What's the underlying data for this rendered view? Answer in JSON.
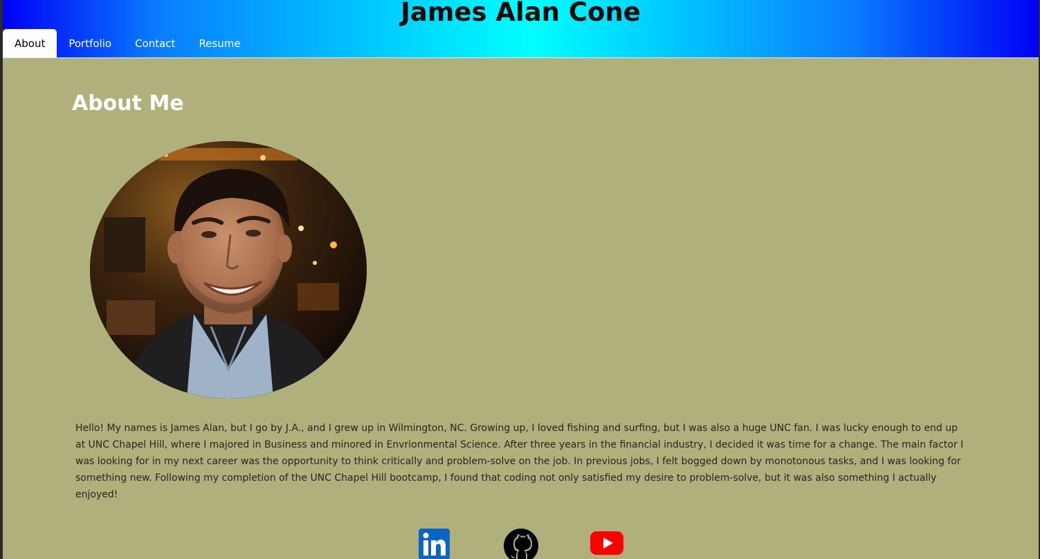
{
  "header": {
    "title": "James Alan Cone",
    "gradient_colors": [
      "#0000f6",
      "#00ffff",
      "#0000f6"
    ]
  },
  "nav": {
    "tabs": [
      {
        "label": "About",
        "active": true
      },
      {
        "label": "Portfolio",
        "active": false
      },
      {
        "label": "Contact",
        "active": false
      },
      {
        "label": "Resume",
        "active": false
      }
    ]
  },
  "about": {
    "heading": "About Me",
    "photo_icon": "profile-photo",
    "bio": "Hello! My names is James Alan, but I go by J.A., and I grew up in Wilmington, NC. Growing up, I loved fishing and surfing, but I was also a huge UNC fan. I was lucky enough to end up at UNC Chapel Hill, where I majored in Business and minored in Envrionmental Science. After three years in the financial industry, I decided it was time for a change. The main factor I was looking for in my next career was the opportunity to think critically and problem-solve on the job. In previous jobs, I felt bogged down by monotonous tasks, and I was looking for something new. Following my completion of the UNC Chapel Hill bootcamp, I found that coding not only satisfied my desire to problem-solve, but it was also something I actually enjoyed!"
  },
  "social": {
    "links": [
      {
        "icon": "linkedin-icon",
        "color": "#0a66c2"
      },
      {
        "icon": "github-icon",
        "color": "#000000"
      },
      {
        "icon": "youtube-icon",
        "color": "#ff0000"
      }
    ]
  },
  "colors": {
    "page_background": "#afb07b",
    "heading": "#ffffff",
    "body_text": "#262620"
  }
}
